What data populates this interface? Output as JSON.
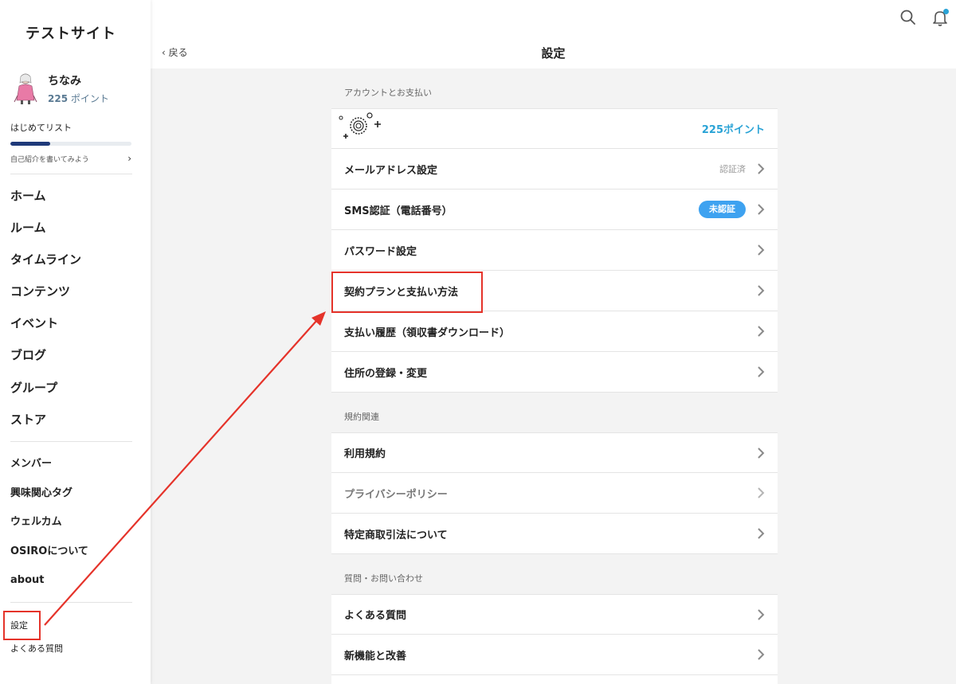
{
  "sidebar": {
    "site_title": "テストサイト",
    "profile": {
      "name": "ちなみ",
      "points_value": "225",
      "points_unit": "ポイント"
    },
    "checklist": {
      "title": "はじめてリスト",
      "hint": "自己紹介を書いてみよう",
      "progress": 0.33
    },
    "main_nav": [
      "ホーム",
      "ルーム",
      "タイムライン",
      "コンテンツ",
      "イベント",
      "ブログ",
      "グループ",
      "ストア"
    ],
    "sub_nav": [
      "メンバー",
      "興味関心タグ",
      "ウェルカム",
      "OSIROについて",
      "about"
    ],
    "footer_nav": [
      "設定",
      "よくある質問"
    ]
  },
  "header": {
    "back_label": "戻る",
    "title": "設定"
  },
  "sections": [
    {
      "title": "アカウントとお支払い",
      "rows": [
        {
          "type": "points",
          "value": "225ポイント"
        },
        {
          "label": "メールアドレス設定",
          "status": "認証済"
        },
        {
          "label": "SMS認証（電話番号）",
          "badge": "未認証"
        },
        {
          "label": "パスワード設定"
        },
        {
          "label": "契約プランと支払い方法"
        },
        {
          "label": "支払い履歴（領収書ダウンロード）"
        },
        {
          "label": "住所の登録・変更"
        }
      ]
    },
    {
      "title": "規約関連",
      "rows": [
        {
          "label": "利用規約"
        },
        {
          "label": "プライバシーポリシー",
          "muted": true
        },
        {
          "label": "特定商取引法について"
        }
      ]
    },
    {
      "title": "質問・お問い合わせ",
      "rows": [
        {
          "label": "よくある質問"
        },
        {
          "label": "新機能と改善"
        },
        {
          "label": ""
        }
      ]
    }
  ],
  "colors": {
    "accent": "#2aa3d6",
    "badge": "#3ea2f0",
    "highlight": "#e5332a",
    "progress": "#1f3a7a"
  },
  "icons": [
    "search-icon",
    "bell-icon",
    "chevron-left-icon",
    "chevron-right-icon",
    "points-icon",
    "avatar"
  ]
}
